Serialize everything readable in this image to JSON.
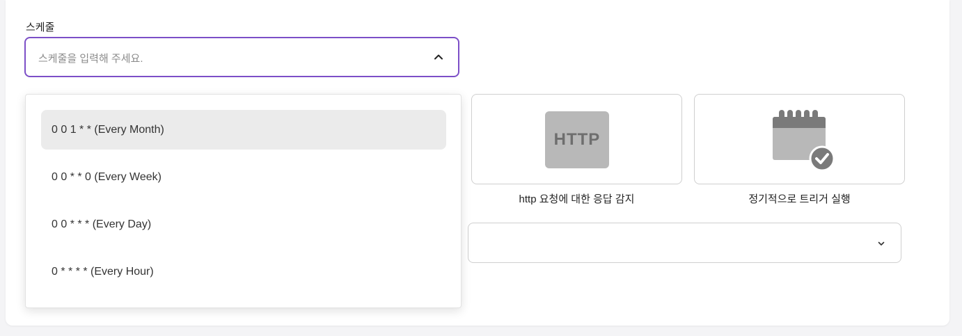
{
  "schedule": {
    "label": "스케줄",
    "placeholder": "스케줄을 입력해 주세요.",
    "options": [
      {
        "label": "0 0 1 * * (Every Month)",
        "selected": true
      },
      {
        "label": "0 0 * * 0 (Every Week)",
        "selected": false
      },
      {
        "label": "0 0 * * * (Every Day)",
        "selected": false
      },
      {
        "label": "0 * * * * (Every Hour)",
        "selected": false
      }
    ]
  },
  "triggers": [
    {
      "icon": "http-icon",
      "logo_text": "HTTP",
      "caption": "http 요청에 대한 응답 감지"
    },
    {
      "icon": "calendar-check-icon",
      "caption": "정기적으로 트리거 실행"
    }
  ],
  "colors": {
    "accent": "#7c4fc7",
    "selected_option_bg": "#ebebeb",
    "logo_gray": "#b8b8b8",
    "calendar_dark": "#7a7a7a"
  }
}
